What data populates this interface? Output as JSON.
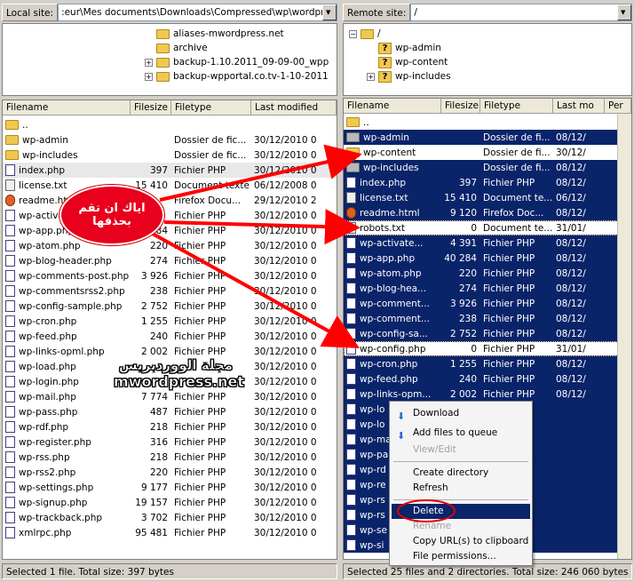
{
  "local_site": {
    "label": "Local site:",
    "path": ":eur\\Mes documents\\Downloads\\Compressed\\wp\\wordpress\\"
  },
  "remote_site": {
    "label": "Remote site:",
    "path": "/"
  },
  "local_tree": [
    {
      "name": "aliases-mwordpress.net",
      "expander": ""
    },
    {
      "name": "archive",
      "expander": ""
    },
    {
      "name": "backup-1.10.2011_09-09-00_wpp",
      "expander": "+"
    },
    {
      "name": "backup-wpportal.co.tv-1-10-2011",
      "expander": "+"
    }
  ],
  "remote_tree": [
    {
      "name": "/",
      "expander": "−",
      "icon": "folder"
    },
    {
      "name": "wp-admin",
      "expander": "",
      "icon": "question"
    },
    {
      "name": "wp-content",
      "expander": "",
      "icon": "question"
    },
    {
      "name": "wp-includes",
      "expander": "+",
      "icon": "question"
    }
  ],
  "local_headers": [
    "Filename",
    "Filesize",
    "Filetype",
    "Last modified"
  ],
  "remote_headers": [
    "Filename",
    "Filesize",
    "Filetype",
    "Last mo",
    "Per"
  ],
  "local_files": [
    {
      "name": "..",
      "size": "",
      "type": "",
      "date": "",
      "icon": "folder"
    },
    {
      "name": "wp-admin",
      "size": "",
      "type": "Dossier de fic...",
      "date": "30/12/2010 0",
      "icon": "folder"
    },
    {
      "name": "wp-includes",
      "size": "",
      "type": "Dossier de fic...",
      "date": "30/12/2010 0",
      "icon": "folder"
    },
    {
      "name": "index.php",
      "size": "397",
      "type": "Fichier PHP",
      "date": "30/12/2010 0",
      "icon": "php"
    },
    {
      "name": "license.txt",
      "size": "15 410",
      "type": "Document texte",
      "date": "06/12/2008 0",
      "icon": "txt"
    },
    {
      "name": "readme.ht",
      "size": "",
      "type": "Firefox Docu...",
      "date": "29/12/2010 2",
      "icon": "ff"
    },
    {
      "name": "wp-activa",
      "size": "",
      "type": "Fichier PHP",
      "date": "30/12/2010 0",
      "icon": "php"
    },
    {
      "name": "wp-app.php",
      "size": "284",
      "type": "Fichier PHP",
      "date": "30/12/2010 0",
      "icon": "php"
    },
    {
      "name": "wp-atom.php",
      "size": "220",
      "type": "Fichier PHP",
      "date": "30/12/2010 0",
      "icon": "php"
    },
    {
      "name": "wp-blog-header.php",
      "size": "274",
      "type": "Fichier PHP",
      "date": "30/12/2010 0",
      "icon": "php"
    },
    {
      "name": "wp-comments-post.php",
      "size": "3 926",
      "type": "Fichier PHP",
      "date": "30/12/2010 0",
      "icon": "php"
    },
    {
      "name": "wp-commentsrss2.php",
      "size": "238",
      "type": "Fichier PHP",
      "date": "30/12/2010 0",
      "icon": "php"
    },
    {
      "name": "wp-config-sample.php",
      "size": "2 752",
      "type": "Fichier PHP",
      "date": "30/12/2010 0",
      "icon": "php"
    },
    {
      "name": "wp-cron.php",
      "size": "1 255",
      "type": "Fichier PHP",
      "date": "30/12/2010 0",
      "icon": "php"
    },
    {
      "name": "wp-feed.php",
      "size": "240",
      "type": "Fichier PHP",
      "date": "30/12/2010 0",
      "icon": "php"
    },
    {
      "name": "wp-links-opml.php",
      "size": "2 002",
      "type": "Fichier PHP",
      "date": "30/12/2010 0",
      "icon": "php"
    },
    {
      "name": "wp-load.php",
      "size": "",
      "type": "",
      "date": "30/12/2010 0",
      "icon": "php"
    },
    {
      "name": "wp-login.php",
      "size": "",
      "type": "",
      "date": "30/12/2010 0",
      "icon": "php"
    },
    {
      "name": "wp-mail.php",
      "size": "7 774",
      "type": "Fichier PHP",
      "date": "30/12/2010 0",
      "icon": "php"
    },
    {
      "name": "wp-pass.php",
      "size": "487",
      "type": "Fichier PHP",
      "date": "30/12/2010 0",
      "icon": "php"
    },
    {
      "name": "wp-rdf.php",
      "size": "218",
      "type": "Fichier PHP",
      "date": "30/12/2010 0",
      "icon": "php"
    },
    {
      "name": "wp-register.php",
      "size": "316",
      "type": "Fichier PHP",
      "date": "30/12/2010 0",
      "icon": "php"
    },
    {
      "name": "wp-rss.php",
      "size": "218",
      "type": "Fichier PHP",
      "date": "30/12/2010 0",
      "icon": "php"
    },
    {
      "name": "wp-rss2.php",
      "size": "220",
      "type": "Fichier PHP",
      "date": "30/12/2010 0",
      "icon": "php"
    },
    {
      "name": "wp-settings.php",
      "size": "9 177",
      "type": "Fichier PHP",
      "date": "30/12/2010 0",
      "icon": "php"
    },
    {
      "name": "wp-signup.php",
      "size": "19 157",
      "type": "Fichier PHP",
      "date": "30/12/2010 0",
      "icon": "php"
    },
    {
      "name": "wp-trackback.php",
      "size": "3 702",
      "type": "Fichier PHP",
      "date": "30/12/2010 0",
      "icon": "php"
    },
    {
      "name": "xmlrpc.php",
      "size": "95 481",
      "type": "Fichier PHP",
      "date": "30/12/2010 0",
      "icon": "php"
    }
  ],
  "remote_files": [
    {
      "name": "..",
      "size": "",
      "type": "",
      "date": "",
      "icon": "folder",
      "sel": false
    },
    {
      "name": "wp-admin",
      "size": "",
      "type": "Dossier de fi...",
      "date": "08/12/",
      "icon": "grey",
      "sel": true
    },
    {
      "name": "wp-content",
      "size": "",
      "type": "Dossier de fi...",
      "date": "30/12/",
      "icon": "folder",
      "sel": false
    },
    {
      "name": "wp-includes",
      "size": "",
      "type": "Dossier de fi...",
      "date": "08/12/",
      "icon": "grey",
      "sel": true
    },
    {
      "name": "index.php",
      "size": "397",
      "type": "Fichier PHP",
      "date": "08/12/",
      "icon": "php",
      "sel": true
    },
    {
      "name": "license.txt",
      "size": "15 410",
      "type": "Document te...",
      "date": "06/12/",
      "icon": "txt",
      "sel": true
    },
    {
      "name": "readme.html",
      "size": "9 120",
      "type": "Firefox Doc...",
      "date": "08/12/",
      "icon": "ff",
      "sel": true
    },
    {
      "name": "robots.txt",
      "size": "0",
      "type": "Document te...",
      "date": "31/01/",
      "icon": "txt",
      "sel": false
    },
    {
      "name": "wp-activate...",
      "size": "4 391",
      "type": "Fichier PHP",
      "date": "08/12/",
      "icon": "php",
      "sel": true
    },
    {
      "name": "wp-app.php",
      "size": "40 284",
      "type": "Fichier PHP",
      "date": "08/12/",
      "icon": "php",
      "sel": true
    },
    {
      "name": "wp-atom.php",
      "size": "220",
      "type": "Fichier PHP",
      "date": "08/12/",
      "icon": "php",
      "sel": true
    },
    {
      "name": "wp-blog-hea...",
      "size": "274",
      "type": "Fichier PHP",
      "date": "08/12/",
      "icon": "php",
      "sel": true
    },
    {
      "name": "wp-comment...",
      "size": "3 926",
      "type": "Fichier PHP",
      "date": "08/12/",
      "icon": "php",
      "sel": true
    },
    {
      "name": "wp-comment...",
      "size": "238",
      "type": "Fichier PHP",
      "date": "08/12/",
      "icon": "php",
      "sel": true
    },
    {
      "name": "wp-config-sa...",
      "size": "2 752",
      "type": "Fichier PHP",
      "date": "08/12/",
      "icon": "php",
      "sel": true
    },
    {
      "name": "wp-config.php",
      "size": "0",
      "type": "Fichier PHP",
      "date": "31/01/",
      "icon": "php",
      "sel": false
    },
    {
      "name": "wp-cron.php",
      "size": "1 255",
      "type": "Fichier PHP",
      "date": "08/12/",
      "icon": "php",
      "sel": true
    },
    {
      "name": "wp-feed.php",
      "size": "240",
      "type": "Fichier PHP",
      "date": "08/12/",
      "icon": "php",
      "sel": true
    },
    {
      "name": "wp-links-opm...",
      "size": "2 002",
      "type": "Fichier PHP",
      "date": "08/12/",
      "icon": "php",
      "sel": true
    },
    {
      "name": "wp-lo",
      "size": "",
      "type": "",
      "date": "",
      "icon": "php",
      "sel": true
    },
    {
      "name": "wp-lo",
      "size": "",
      "type": "",
      "date": "",
      "icon": "php",
      "sel": true
    },
    {
      "name": "wp-ma",
      "size": "",
      "type": "",
      "date": "",
      "icon": "php",
      "sel": true
    },
    {
      "name": "wp-pa",
      "size": "",
      "type": "",
      "date": "",
      "icon": "php",
      "sel": true
    },
    {
      "name": "wp-rd",
      "size": "",
      "type": "",
      "date": "",
      "icon": "php",
      "sel": true
    },
    {
      "name": "wp-re",
      "size": "",
      "type": "",
      "date": "",
      "icon": "php",
      "sel": true
    },
    {
      "name": "wp-rs",
      "size": "",
      "type": "",
      "date": "",
      "icon": "php",
      "sel": true
    },
    {
      "name": "wp-rs",
      "size": "",
      "type": "",
      "date": "",
      "icon": "php",
      "sel": true
    },
    {
      "name": "wp-se",
      "size": "",
      "type": "",
      "date": "",
      "icon": "php",
      "sel": true
    },
    {
      "name": "wp-si",
      "size": "",
      "type": "",
      "date": "",
      "icon": "php",
      "sel": true
    }
  ],
  "context_menu": {
    "download": "Download",
    "add_to_queue": "Add files to queue",
    "view_edit": "View/Edit",
    "create_directory": "Create directory",
    "refresh": "Refresh",
    "delete": "Delete",
    "rename": "Rename",
    "copy_urls": "Copy URL(s) to clipboard",
    "file_permissions": "File permissions..."
  },
  "status": {
    "local": "Selected 1 file. Total size: 397 bytes",
    "remote": "Selected 25 files and 2 directories. Total size: 246 060 bytes"
  },
  "annotation": {
    "bubble_line1": "اياك ان تقم",
    "bubble_line2": "بحذفها",
    "watermark_ar": "مجلة الووردبريس",
    "watermark_en": "mwordpress.net"
  },
  "colors": {
    "selection": "#0a246a",
    "bubble": "#e8001c",
    "arrow": "#ff0000"
  }
}
